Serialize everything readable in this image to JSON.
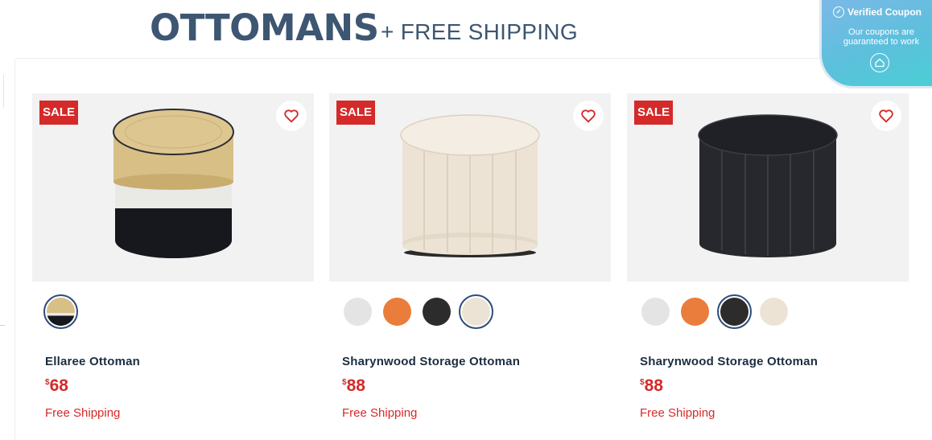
{
  "header": {
    "title": "OTTOMANS",
    "subtitle": "+ FREE SHIPPING"
  },
  "coupon": {
    "title": "Verified Coupon",
    "text": "Our coupons are guaranteed to work"
  },
  "products": [
    {
      "badge": "SALE",
      "name": "Ellaree Ottoman",
      "currency": "$",
      "price": "68",
      "shipping": "Free Shipping",
      "swatches": [
        "#d8bf86"
      ],
      "selected_swatch": 0
    },
    {
      "badge": "SALE",
      "name": "Sharynwood Storage Ottoman",
      "currency": "$",
      "price": "88",
      "shipping": "Free Shipping",
      "swatches": [
        "#e4e4e4",
        "#ea7d3b",
        "#2c2c2c",
        "#ece3d5"
      ],
      "selected_swatch": 3
    },
    {
      "badge": "SALE",
      "name": "Sharynwood Storage Ottoman",
      "currency": "$",
      "price": "88",
      "shipping": "Free Shipping",
      "swatches": [
        "#e4e4e4",
        "#ea7d3b",
        "#2c2c2c",
        "#ece3d5"
      ],
      "selected_swatch": 2
    }
  ],
  "colors": {
    "accent_red": "#d42a29",
    "title_blue": "#3d5672"
  }
}
